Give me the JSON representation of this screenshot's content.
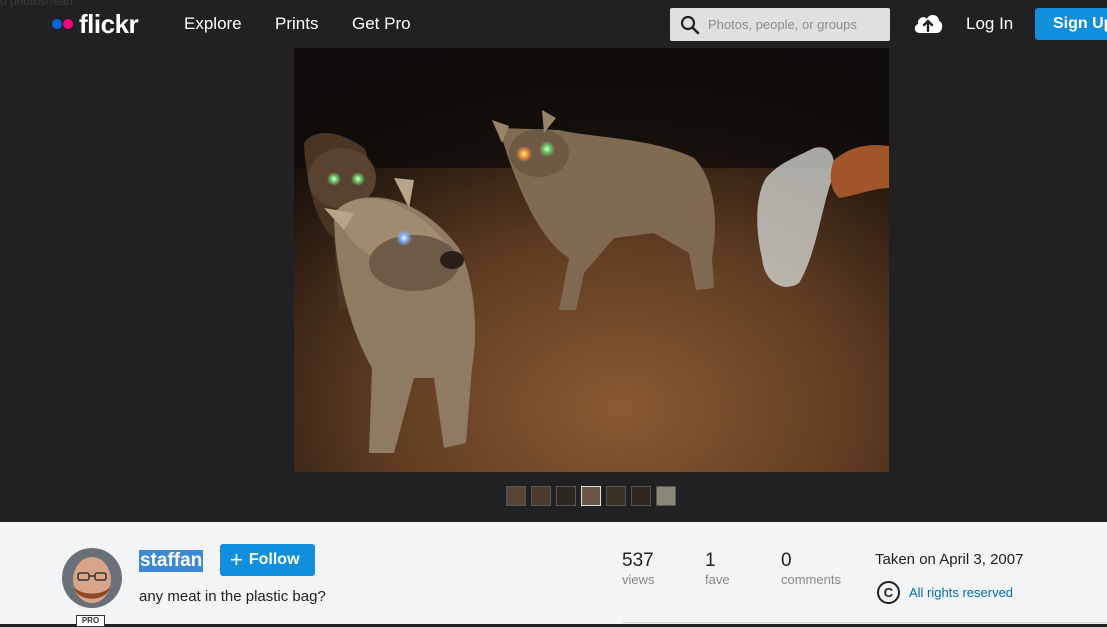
{
  "header": {
    "faint_text": "o photos/fean",
    "logo_text": "flickr",
    "nav": [
      "Explore",
      "Prints",
      "Get Pro"
    ],
    "search_placeholder": "Photos, people, or groups",
    "login_label": "Log In",
    "signup_label": "Sign Up"
  },
  "photo": {
    "icon": "hyena-photo"
  },
  "filmstrip": {
    "count": 7,
    "active_index": 3,
    "colors": [
      "#5a4636",
      "#4a3a2c",
      "#2c2620",
      "#6a5644",
      "#3a3026",
      "#2e261f",
      "#8c8878"
    ]
  },
  "owner": {
    "name": "staffan",
    "pro_label": "PRO",
    "follow_label": "Follow"
  },
  "photo_title": "any meat in the plastic bag?",
  "stats": {
    "views": {
      "value": "537",
      "label": "views"
    },
    "faves": {
      "value": "1",
      "label": "fave"
    },
    "comments": {
      "value": "0",
      "label": "comments"
    }
  },
  "taken": "Taken on April 3, 2007",
  "license": {
    "icon_text": "C",
    "label": "All rights reserved"
  },
  "colors": {
    "brand_blue": "#0063dc",
    "brand_pink": "#ff0084",
    "button_blue": "#128fdc",
    "link_blue": "#006dac"
  }
}
